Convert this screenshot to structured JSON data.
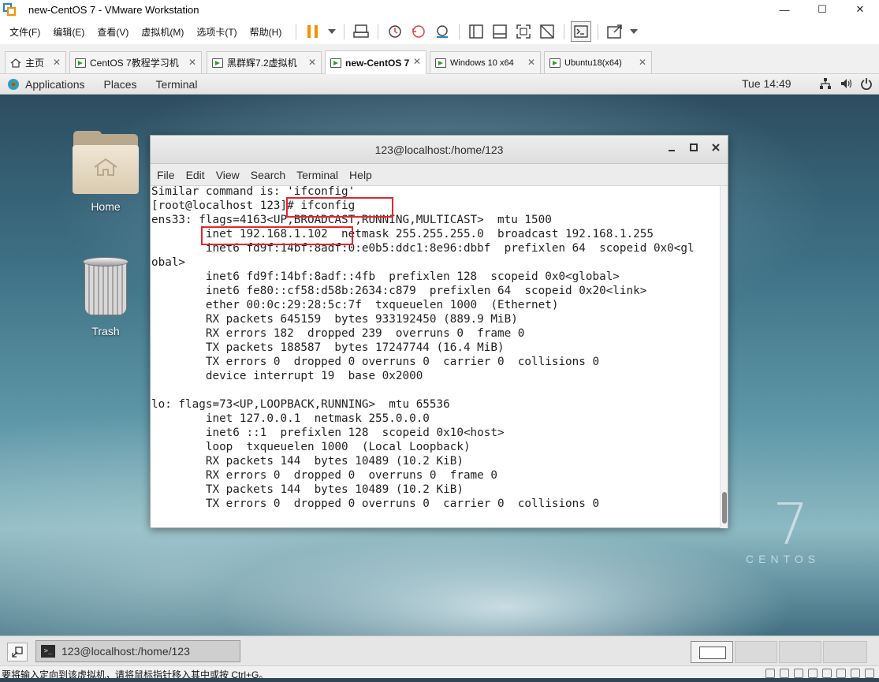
{
  "window": {
    "title": "new-CentOS 7 - VMware Workstation",
    "controls": {
      "minimize": "—",
      "maximize": "☐",
      "close": "✕"
    }
  },
  "menubar": {
    "items": [
      "文件(F)",
      "编辑(E)",
      "查看(V)",
      "虚拟机(M)",
      "选项卡(T)",
      "帮助(H)"
    ]
  },
  "tabs": [
    {
      "label": "主页",
      "icon": "home-icon",
      "active": false
    },
    {
      "label": "CentOS 7教程学习机",
      "icon": "vm-icon",
      "active": false
    },
    {
      "label": "黑群辉7.2虚拟机",
      "icon": "vm-icon",
      "active": false
    },
    {
      "label": "new-CentOS 7",
      "icon": "vm-icon",
      "active": true
    },
    {
      "label": "Windows 10 x64",
      "icon": "vm-icon",
      "active": false
    },
    {
      "label": "Ubuntu18(x64)",
      "icon": "vm-icon",
      "active": false
    }
  ],
  "gnome_panel": {
    "applications": "Applications",
    "places": "Places",
    "terminal": "Terminal",
    "clock": "Tue 14:49"
  },
  "desktop_icons": [
    {
      "label": "Home",
      "icon": "home-folder-icon"
    },
    {
      "label": "Trash",
      "icon": "trash-icon"
    }
  ],
  "centos_logo": {
    "number": "7",
    "name": "CENTOS"
  },
  "terminal": {
    "title": "123@localhost:/home/123",
    "menu": [
      "File",
      "Edit",
      "View",
      "Search",
      "Terminal",
      "Help"
    ],
    "lines": [
      "Similar command is: 'ifconfig'",
      "[root@localhost 123]# ifconfig",
      "ens33: flags=4163<UP,BROADCAST,RUNNING,MULTICAST>  mtu 1500",
      "        inet 192.168.1.102  netmask 255.255.255.0  broadcast 192.168.1.255",
      "        inet6 fd9f:14bf:8adf:0:e0b5:ddc1:8e96:dbbf  prefixlen 64  scopeid 0x0<gl",
      "obal>",
      "        inet6 fd9f:14bf:8adf::4fb  prefixlen 128  scopeid 0x0<global>",
      "        inet6 fe80::cf58:d58b:2634:c879  prefixlen 64  scopeid 0x20<link>",
      "        ether 00:0c:29:28:5c:7f  txqueuelen 1000  (Ethernet)",
      "        RX packets 645159  bytes 933192450 (889.9 MiB)",
      "        RX errors 182  dropped 239  overruns 0  frame 0",
      "        TX packets 188587  bytes 17247744 (16.4 MiB)",
      "        TX errors 0  dropped 0 overruns 0  carrier 0  collisions 0",
      "        device interrupt 19  base 0x2000",
      "",
      "lo: flags=73<UP,LOOPBACK,RUNNING>  mtu 65536",
      "        inet 127.0.0.1  netmask 255.0.0.0",
      "        inet6 ::1  prefixlen 128  scopeid 0x10<host>",
      "        loop  txqueuelen 1000  (Local Loopback)",
      "        RX packets 144  bytes 10489 (10.2 KiB)",
      "        RX errors 0  dropped 0  overruns 0  frame 0",
      "        TX packets 144  bytes 10489 (10.2 KiB)",
      "        TX errors 0  dropped 0 overruns 0  carrier 0  collisions 0"
    ],
    "highlights": [
      "# ifconfig",
      "inet 192.168.1.102"
    ]
  },
  "taskbar": {
    "window_item": "123@localhost:/home/123"
  },
  "status_bar": {
    "message": "要将输入定向到该虚拟机，请将鼠标指针移入其中或按 Ctrl+G。"
  },
  "colors": {
    "highlight_box": "#e3272c",
    "pause_accent": "#f29100"
  }
}
